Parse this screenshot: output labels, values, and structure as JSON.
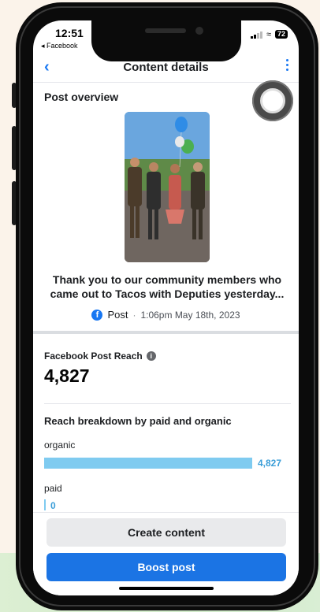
{
  "status_bar": {
    "time": "12:51",
    "back_app": "◂ Facebook",
    "battery": "72"
  },
  "header": {
    "back_icon": "chevron-left-icon",
    "title": "Content details",
    "more_icon": "vertical-dots-icon"
  },
  "overview": {
    "title": "Post overview",
    "caption": "Thank you to our community members who came out to Tacos with Deputies yesterday...",
    "post_type": "Post",
    "separator": "·",
    "timestamp": "1:06pm May 18th, 2023"
  },
  "reach": {
    "title": "Facebook Post Reach",
    "value": "4,827",
    "breakdown_title": "Reach breakdown by paid and organic",
    "rows": [
      {
        "label": "organic",
        "value": "4,827",
        "fraction": 1.0
      },
      {
        "label": "paid",
        "value": "0",
        "fraction": 0.0
      }
    ]
  },
  "actions": {
    "create_label": "Create content",
    "boost_label": "Boost post"
  },
  "colors": {
    "accent": "#1877f2",
    "boost": "#1b74e4",
    "bar": "#7fcbf0",
    "bar_value": "#3b9ed8"
  }
}
